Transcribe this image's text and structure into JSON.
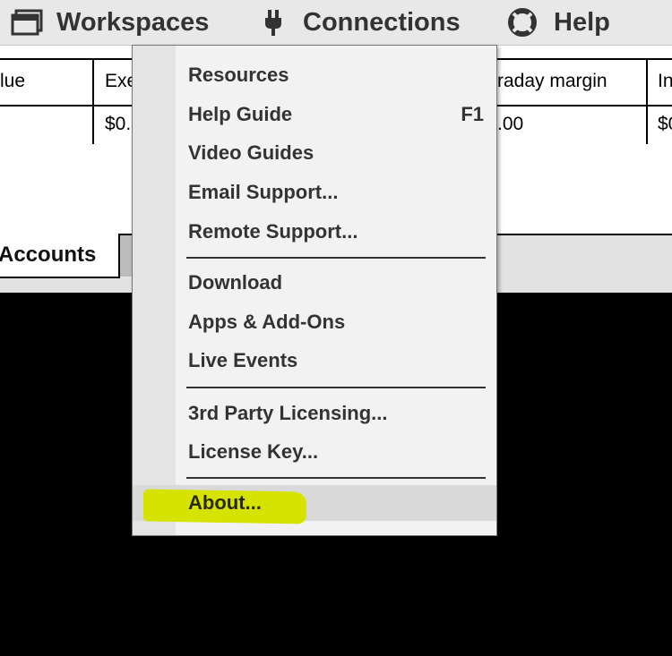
{
  "menubar": {
    "workspaces": {
      "label": "Workspaces",
      "icon": "window-icon"
    },
    "connections": {
      "label": "Connections",
      "icon": "plug-icon"
    },
    "help": {
      "label": "Help",
      "icon": "lifebuoy-icon"
    }
  },
  "table": {
    "headers": [
      "lue",
      "Exe",
      "raday margin",
      "In"
    ],
    "row": [
      "",
      "$0.",
      ".00",
      "$0"
    ]
  },
  "tabs": {
    "active": "Accounts"
  },
  "help_menu": {
    "items": [
      {
        "label": "Resources",
        "shortcut": ""
      },
      {
        "label": "Help Guide",
        "shortcut": "F1"
      },
      {
        "label": "Video Guides",
        "shortcut": ""
      },
      {
        "label": "Email Support...",
        "shortcut": ""
      },
      {
        "label": "Remote Support...",
        "shortcut": ""
      },
      {
        "label": "Download",
        "shortcut": ""
      },
      {
        "label": "Apps & Add-Ons",
        "shortcut": ""
      },
      {
        "label": "Live Events",
        "shortcut": ""
      },
      {
        "label": "3rd Party Licensing...",
        "shortcut": ""
      },
      {
        "label": "License Key...",
        "shortcut": ""
      },
      {
        "label": "About...",
        "shortcut": ""
      }
    ],
    "highlighted_item": "About...",
    "highlight_color": "#d6e300"
  }
}
